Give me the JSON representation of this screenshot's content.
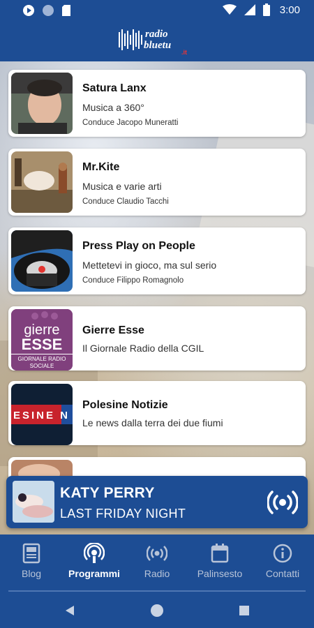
{
  "status_bar": {
    "time": "3:00",
    "left_icons": [
      "play-icon",
      "circle-icon",
      "sd-card-icon"
    ],
    "right_icons": [
      "wifi-icon",
      "signal-icon",
      "battery-icon"
    ]
  },
  "app": {
    "logo_text": "radio bluetu"
  },
  "programs": [
    {
      "title": "Satura Lanx",
      "subtitle": "Musica a 360°",
      "host": "Conduce Jacopo Muneratti"
    },
    {
      "title": "Mr.Kite",
      "subtitle": "Musica e varie arti",
      "host": "Conduce Claudio Tacchi"
    },
    {
      "title": "Press Play on People",
      "subtitle": "Mettetevi in gioco, ma sul serio",
      "host": "Conduce Filippo Romagnolo"
    },
    {
      "title": "Gierre Esse",
      "subtitle": "Il Giornale Radio della CGIL",
      "host": "",
      "thumb_text": {
        "line1": "gierre",
        "line2": "ESSE",
        "line3": "GIORNALE RADIO",
        "line4": "SOCIALE"
      }
    },
    {
      "title": "Polesine Notizie",
      "subtitle": "Le news dalla terra dei due fiumi",
      "host": "",
      "thumb_text": "ESINE N"
    }
  ],
  "now_playing": {
    "artist": "KATY PERRY",
    "track": "LAST FRIDAY NIGHT"
  },
  "bottom_nav": [
    {
      "label": "Blog",
      "icon": "newspaper-icon",
      "active": false
    },
    {
      "label": "Programmi",
      "icon": "podcast-icon",
      "active": true
    },
    {
      "label": "Radio",
      "icon": "broadcast-icon",
      "active": false
    },
    {
      "label": "Palinsesto",
      "icon": "calendar-icon",
      "active": false
    },
    {
      "label": "Contatti",
      "icon": "info-icon",
      "active": false
    }
  ],
  "colors": {
    "primary": "#1d4d94",
    "card": "#ffffff",
    "inactive_nav": "#b8c4d8"
  }
}
